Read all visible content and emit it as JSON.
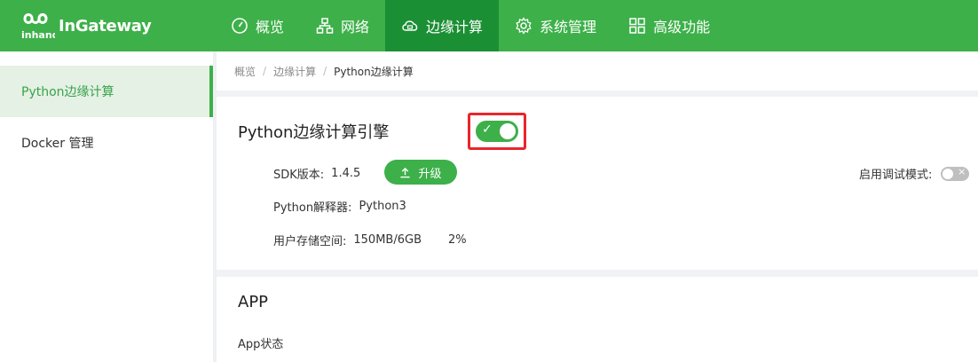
{
  "brand": {
    "name": "InGateway",
    "mark_text": "inhand"
  },
  "nav": [
    {
      "label": "概览",
      "icon": "dashboard-icon"
    },
    {
      "label": "网络",
      "icon": "network-icon"
    },
    {
      "label": "边缘计算",
      "icon": "cloud-compute-icon",
      "active": true
    },
    {
      "label": "系统管理",
      "icon": "gear-icon"
    },
    {
      "label": "高级功能",
      "icon": "grid-icon"
    }
  ],
  "sidebar": {
    "items": [
      {
        "label": "Python边缘计算",
        "active": true
      },
      {
        "label": "Docker 管理"
      }
    ]
  },
  "breadcrumb": [
    "概览",
    "边缘计算",
    "Python边缘计算"
  ],
  "engine": {
    "title": "Python边缘计算引擎",
    "enabled": true,
    "sdk_label": "SDK版本:",
    "sdk_value": "1.4.5",
    "upgrade_label": "升级",
    "interpreter_label": "Python解释器:",
    "interpreter_value": "Python3",
    "storage_label": "用户存储空间:",
    "storage_value": "150MB/6GB",
    "storage_pct": "2%",
    "debug_label": "启用调试模式:",
    "debug_enabled": false
  },
  "app": {
    "title": "APP",
    "status_label": "App状态"
  },
  "colors": {
    "brand_green": "#3db049",
    "active_nav": "#1b8f34",
    "highlight_red": "#e8262b"
  }
}
